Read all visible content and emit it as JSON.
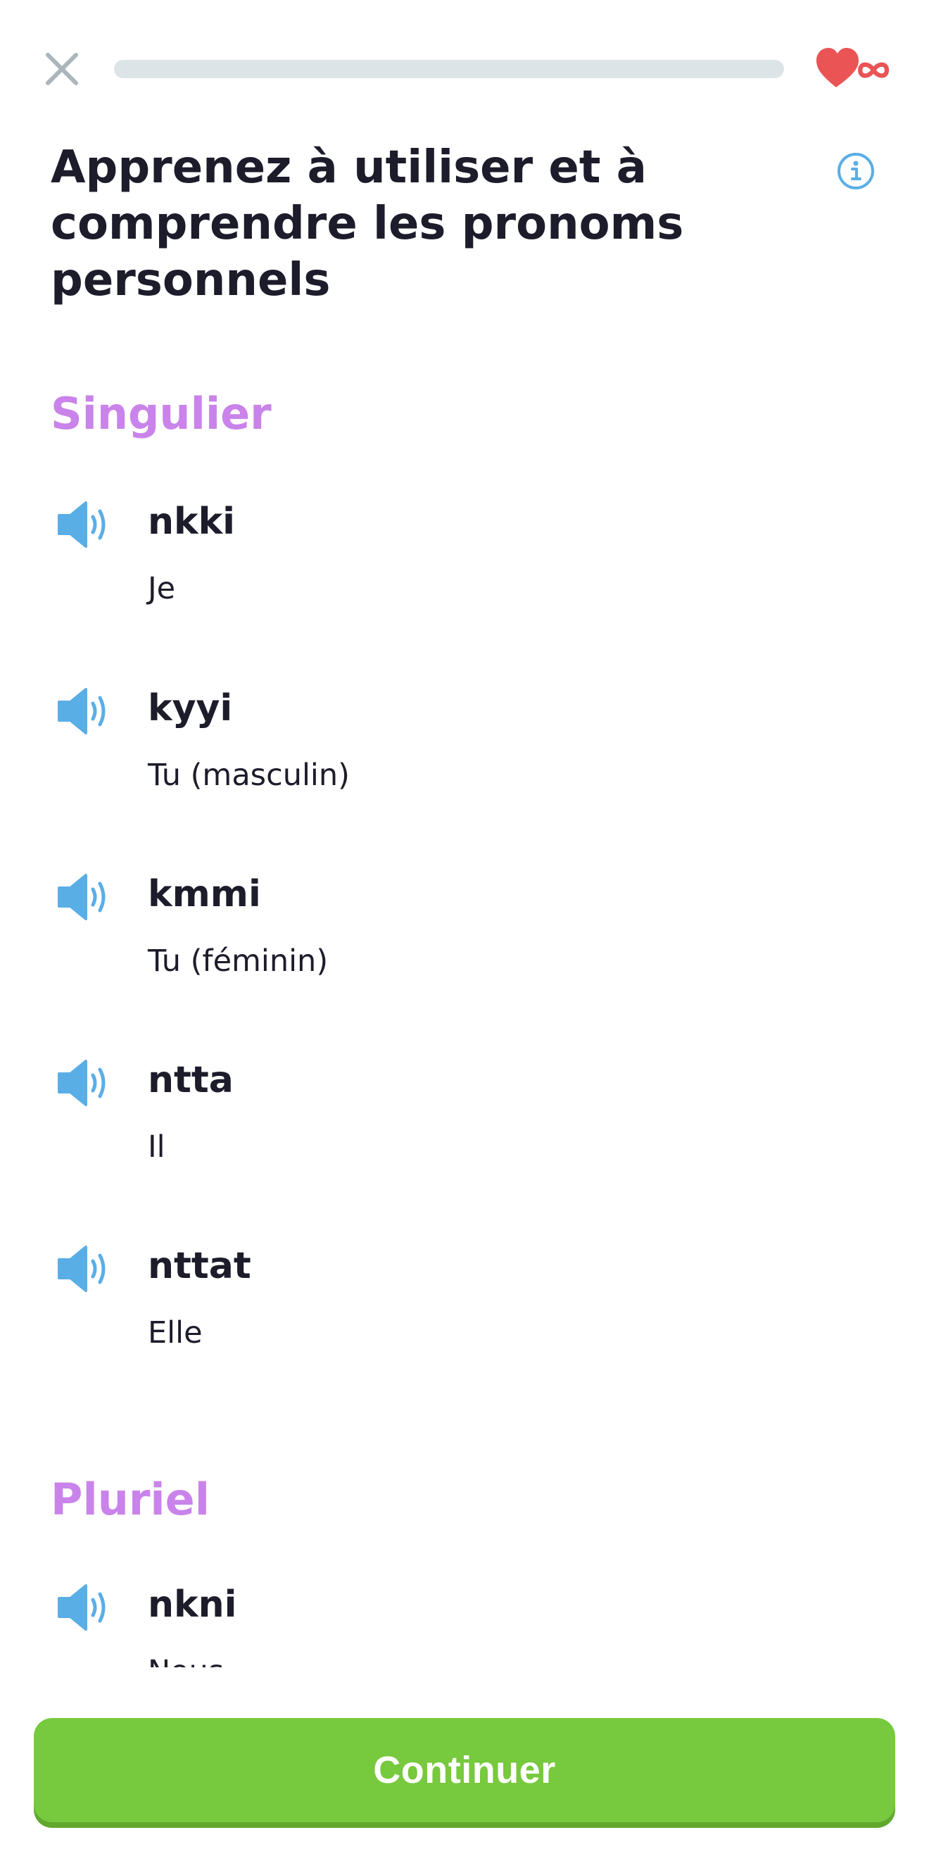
{
  "header": {
    "close_icon": "close-icon",
    "progress": 0,
    "hearts_icon": "heart-infinity-icon",
    "hearts_color": "#ea5455"
  },
  "title": "Apprenez à utiliser et à comprendre les pronoms personnels",
  "info_icon": "info-icon",
  "sections": [
    {
      "heading": "Singulier",
      "entries": [
        {
          "word": "nkki",
          "translation": "Je"
        },
        {
          "word": "kyyi",
          "translation": "Tu (masculin)"
        },
        {
          "word": "kmmi",
          "translation": "Tu (féminin)"
        },
        {
          "word": "ntta",
          "translation": "Il"
        },
        {
          "word": "nttat",
          "translation": "Elle"
        }
      ]
    },
    {
      "heading": "Pluriel",
      "entries": [
        {
          "word": "nkni",
          "translation": "Nous"
        }
      ]
    }
  ],
  "footer": {
    "continue_label": "Continuer"
  },
  "colors": {
    "accent_green": "#77c93d",
    "heading_purple": "#c983ea",
    "speaker_blue": "#5aaee6",
    "text_dark": "#1c1c2b"
  }
}
